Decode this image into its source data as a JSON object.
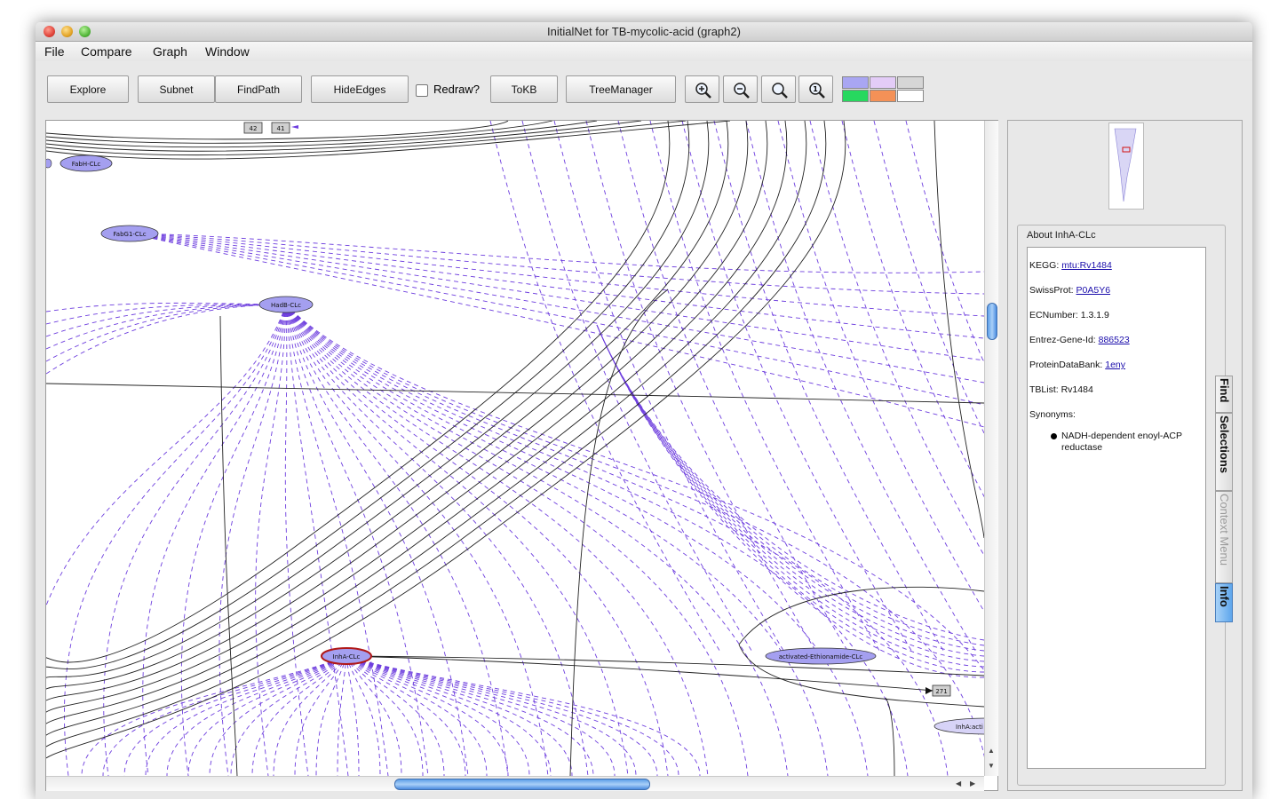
{
  "window": {
    "title": "InitialNet for TB-mycolic-acid (graph2)"
  },
  "menu": [
    "File",
    "Compare",
    "Graph",
    "Window"
  ],
  "toolbar": {
    "explore": "Explore",
    "subnet": "Subnet",
    "findpath": "FindPath",
    "hideedges": "HideEdges",
    "redraw": "Redraw?",
    "tokb": "ToKB",
    "treemanager": "TreeManager",
    "swatch_colors": [
      "#a9a6f2",
      "#e3ccf7",
      "#d6d6d6",
      "#27d85f",
      "#f49157",
      "#ffffff"
    ]
  },
  "graph": {
    "node_labels": {
      "fabh": "FabH-CLc",
      "fabg1": "FabG1-CLc",
      "hadb": "HadB-CLc",
      "inha": "InhA-CLc",
      "activated_ethionamide": "activated-Ethionamide-CLc",
      "inha_active": "InhA:acti"
    },
    "box_labels": {
      "b42": "42",
      "b41": "41",
      "b271": "271"
    },
    "colors": {
      "node_fill": "#a49ff0",
      "selected_border": "#b01818",
      "dashed_edge": "#6d3dde",
      "solid_edge": "#222222"
    }
  },
  "info": {
    "heading": "About InhA-CLc",
    "kegg_label": "KEGG:",
    "kegg_value": "mtu:Rv1484",
    "swissprot_label": "SwissProt:",
    "swissprot_value": "P0A5Y6",
    "ec_text": "ECNumber: 1.3.1.9",
    "entrez_label": "Entrez-Gene-Id:",
    "entrez_value": "886523",
    "pdb_label": "ProteinDataBank:",
    "pdb_value": "1eny",
    "tblist_text": "TBList: Rv1484",
    "synonyms_label": "Synonyms:",
    "synonym_1": "NADH-dependent enoyl-ACP reductase"
  },
  "tabs": {
    "find": "Find",
    "selections": "Selections",
    "context_menu": "Context Menu",
    "info": "Info"
  }
}
